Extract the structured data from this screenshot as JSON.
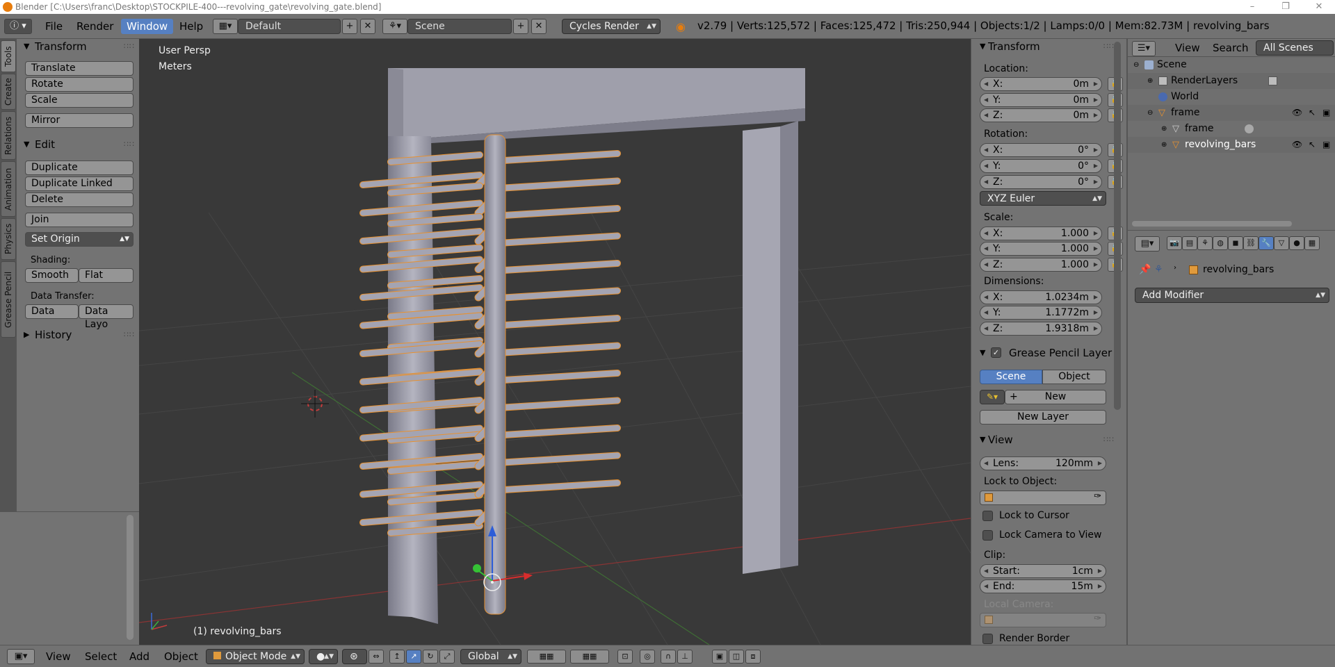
{
  "titlebar": {
    "title": "Blender [C:\\Users\\franc\\Desktop\\STOCKPILE-400---revolving_gate\\revolving_gate.blend]",
    "minimize": "–",
    "maximize": "❐",
    "close": "✕"
  },
  "topbar": {
    "menus": [
      "File",
      "Render",
      "Window",
      "Help"
    ],
    "active_menu": "Window",
    "layout": "Default",
    "scene": "Scene",
    "engine": "Cycles Render",
    "stats": "v2.79 | Verts:125,572 | Faces:125,472 | Tris:250,944 | Objects:1/2 | Lamps:0/0 | Mem:82.73M | revolving_bars"
  },
  "left_tabs": [
    "Tools",
    "Create",
    "Relations",
    "Animation",
    "Physics",
    "Grease Pencil"
  ],
  "toolshelf": {
    "transform": {
      "title": "Transform",
      "buttons": [
        "Translate",
        "Rotate",
        "Scale",
        "Mirror"
      ]
    },
    "edit": {
      "title": "Edit",
      "buttons": [
        "Duplicate",
        "Duplicate Linked",
        "Delete",
        "Join"
      ],
      "set_origin": "Set Origin",
      "shading_label": "Shading:",
      "smooth": "Smooth",
      "flat": "Flat",
      "data_transfer_label": "Data Transfer:",
      "data": "Data",
      "data_layo": "Data Layo"
    },
    "history": {
      "title": "History"
    }
  },
  "viewport": {
    "view_name": "User Persp",
    "units": "Meters",
    "object_label": "(1) revolving_bars",
    "colors": {
      "background": "#393939",
      "grid": "#4a4a4a",
      "x_axis": "#a33a3a",
      "y_axis": "#5a8a3a",
      "mesh": "#9a9aa6",
      "selection": "#e8912f"
    }
  },
  "properties_panel": {
    "transform": {
      "title": "Transform",
      "location_label": "Location:",
      "location": [
        {
          "k": "X:",
          "v": "0m"
        },
        {
          "k": "Y:",
          "v": "0m"
        },
        {
          "k": "Z:",
          "v": "0m"
        }
      ],
      "rotation_label": "Rotation:",
      "rotation": [
        {
          "k": "X:",
          "v": "0°"
        },
        {
          "k": "Y:",
          "v": "0°"
        },
        {
          "k": "Z:",
          "v": "0°"
        }
      ],
      "rotation_mode": "XYZ Euler",
      "scale_label": "Scale:",
      "scale": [
        {
          "k": "X:",
          "v": "1.000"
        },
        {
          "k": "Y:",
          "v": "1.000"
        },
        {
          "k": "Z:",
          "v": "1.000"
        }
      ],
      "dimensions_label": "Dimensions:",
      "dimensions": [
        {
          "k": "X:",
          "v": "1.0234m"
        },
        {
          "k": "Y:",
          "v": "1.1772m"
        },
        {
          "k": "Z:",
          "v": "1.9318m"
        }
      ]
    },
    "grease_pencil": {
      "title": "Grease Pencil Layer",
      "scene_tab": "Scene",
      "object_tab": "Object",
      "new": "New",
      "new_layer": "New Layer"
    },
    "view": {
      "title": "View",
      "lens_label": "Lens:",
      "lens_value": "120mm",
      "lock_to_object": "Lock to Object:",
      "lock_to_cursor": "Lock to Cursor",
      "lock_camera": "Lock Camera to View",
      "clip_label": "Clip:",
      "clip_start_label": "Start:",
      "clip_start": "1cm",
      "clip_end_label": "End:",
      "clip_end": "15m",
      "local_camera": "Local Camera:",
      "render_border": "Render Border"
    }
  },
  "outliner": {
    "header": {
      "view": "View",
      "search": "Search",
      "filter": "All Scenes"
    },
    "items": [
      {
        "label": "Scene",
        "icon": "scene-icon"
      },
      {
        "label": "RenderLayers",
        "icon": "render-layers-icon"
      },
      {
        "label": "World",
        "icon": "world-icon"
      },
      {
        "label": "frame",
        "icon": "object-icon"
      },
      {
        "label": "frame",
        "icon": "mesh-icon"
      },
      {
        "label": "revolving_bars",
        "icon": "object-icon"
      }
    ]
  },
  "modifiers": {
    "object_name": "revolving_bars",
    "add_modifier": "Add Modifier"
  },
  "bottombar": {
    "menus": [
      "View",
      "Select",
      "Add",
      "Object"
    ],
    "mode": "Object Mode",
    "orientation": "Global"
  }
}
